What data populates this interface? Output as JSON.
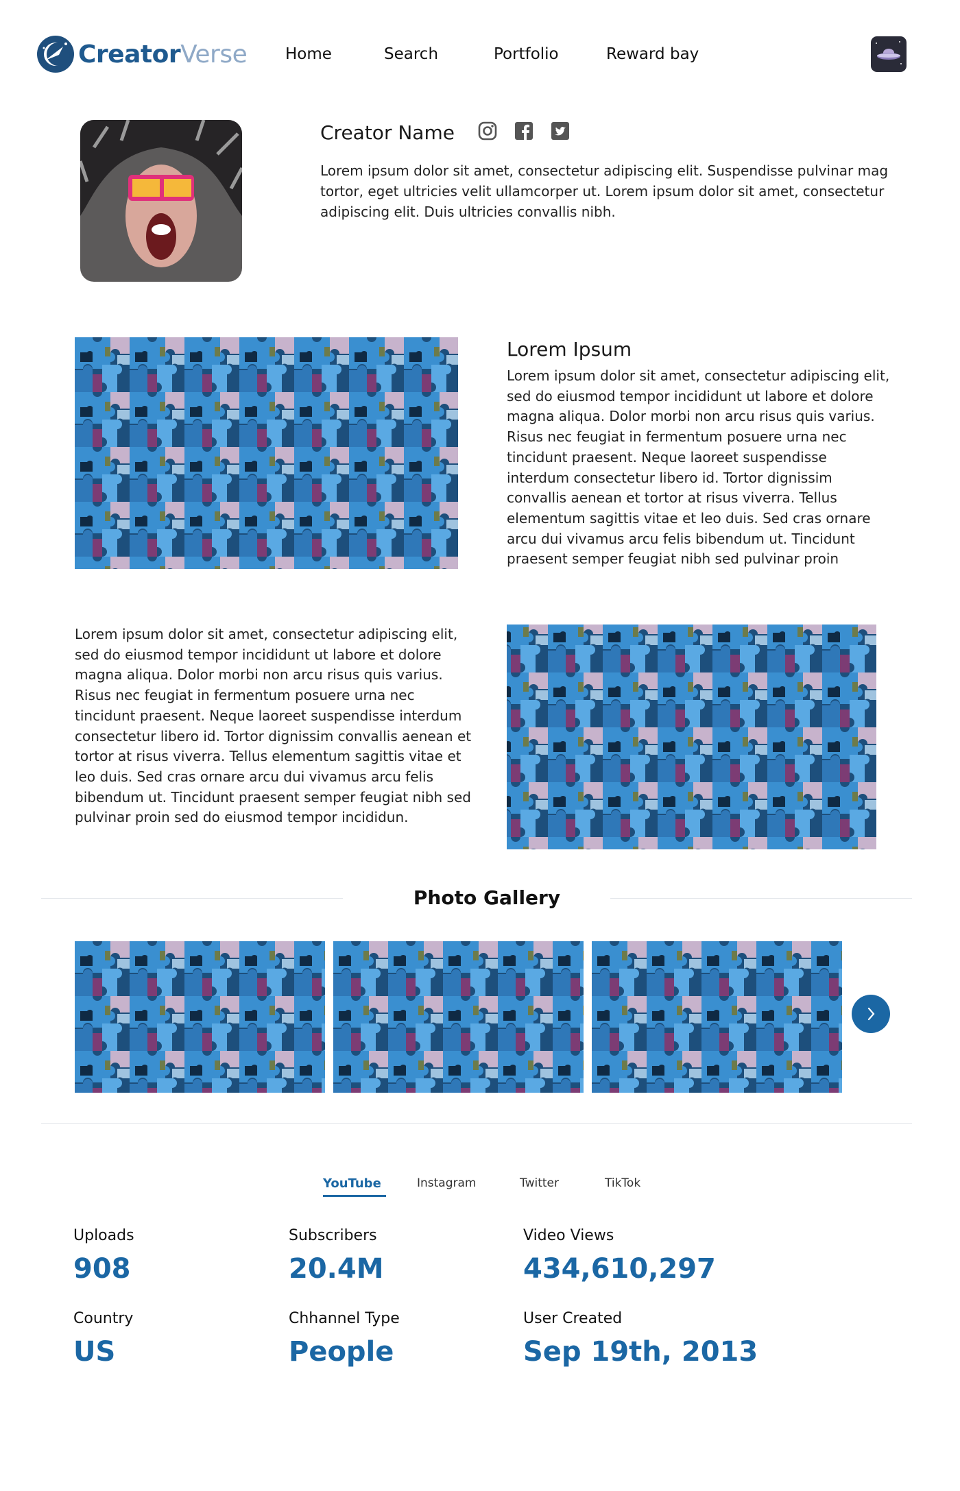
{
  "brand": {
    "name_part1": "Creator",
    "name_part2": "Verse"
  },
  "nav": {
    "items": [
      {
        "label": "Home"
      },
      {
        "label": "Search"
      },
      {
        "label": "Portfolio"
      },
      {
        "label": "Reward bay"
      }
    ]
  },
  "profile": {
    "name": "Creator Name",
    "socials": [
      "instagram-icon",
      "facebook-icon",
      "twitter-icon"
    ],
    "bio": "Lorem ipsum dolor sit amet, consectetur adipiscing elit. Suspendisse pulvinar mag tortor, eget ultricies velit ullamcorper ut. Lorem ipsum dolor sit amet, consectetur adipiscing elit. Duis ultricies convallis nibh."
  },
  "feature1": {
    "title": "Lorem Ipsum",
    "body": "Lorem ipsum dolor sit amet, consectetur adipiscing elit, sed do eiusmod tempor incididunt ut labore et dolore magna aliqua. Dolor morbi non arcu risus quis varius. Risus nec feugiat in fermentum posuere urna nec tincidunt praesent. Neque laoreet suspendisse interdum consectetur libero id. Tortor dignissim convallis aenean et tortor at risus viverra. Tellus elementum sagittis vitae et leo duis. Sed cras ornare arcu dui vivamus arcu felis bibendum ut. Tincidunt praesent semper feugiat nibh sed pulvinar proin"
  },
  "feature2": {
    "body": "Lorem ipsum dolor sit amet, consectetur adipiscing elit, sed do eiusmod tempor incididunt ut labore et dolore magna aliqua. Dolor morbi non arcu risus quis varius. Risus nec feugiat in fermentum posuere urna nec tincidunt praesent. Neque laoreet suspendisse interdum consectetur libero id. Tortor dignissim convallis aenean et tortor at risus viverra. Tellus elementum sagittis vitae et leo duis. Sed cras ornare arcu dui vivamus arcu felis bibendum ut. Tincidunt praesent semper feugiat nibh sed pulvinar proin sed do eiusmod tempor incididun."
  },
  "gallery": {
    "title": "Photo Gallery",
    "next_icon": "chevron-right-icon"
  },
  "tabs": [
    {
      "label": "YouTube",
      "active": true
    },
    {
      "label": "Instagram",
      "active": false
    },
    {
      "label": "Twitter",
      "active": false
    },
    {
      "label": "TikTok",
      "active": false
    }
  ],
  "stats": [
    {
      "label": "Uploads",
      "value": "908"
    },
    {
      "label": "Subscribers",
      "value": "20.4M"
    },
    {
      "label": "Video Views",
      "value": "434,610,297"
    },
    {
      "label": "Country",
      "value": "US"
    },
    {
      "label": "Chhannel Type",
      "value": "People"
    },
    {
      "label": "User Created",
      "value": "Sep 19th, 2013"
    }
  ],
  "colors": {
    "accent": "#1b67a4",
    "brand_dark": "#1f5a8f",
    "brand_light": "#8fa9c7"
  }
}
